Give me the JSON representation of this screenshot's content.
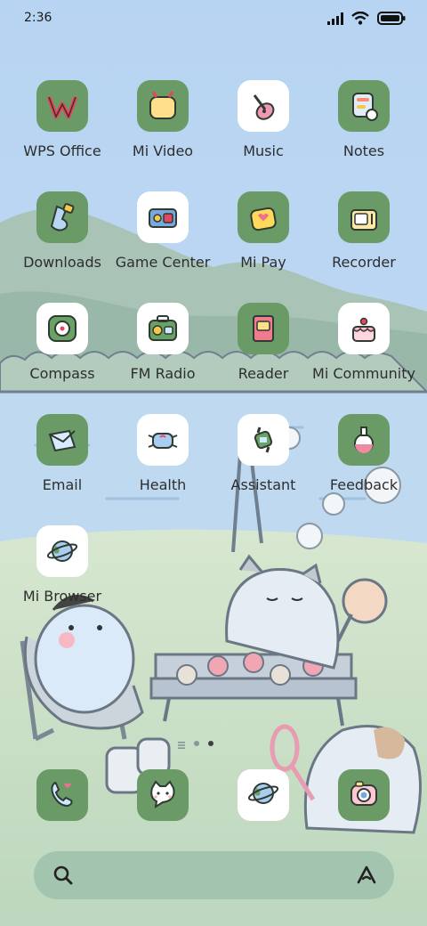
{
  "status_bar": {
    "time": "2:36",
    "icons": [
      "signal-icon",
      "wifi-icon",
      "battery-icon"
    ]
  },
  "apps": [
    {
      "label": "WPS Office",
      "icon": "wps-office-icon"
    },
    {
      "label": "Mi Video",
      "icon": "tv-icon"
    },
    {
      "label": "Music",
      "icon": "guitar-icon"
    },
    {
      "label": "Notes",
      "icon": "notes-icon"
    },
    {
      "label": "Downloads",
      "icon": "downloads-icon"
    },
    {
      "label": "Game Center",
      "icon": "game-console-icon"
    },
    {
      "label": "Mi Pay",
      "icon": "wallet-icon"
    },
    {
      "label": "Recorder",
      "icon": "radio-recorder-icon"
    },
    {
      "label": "Compass",
      "icon": "compass-icon"
    },
    {
      "label": "FM Radio",
      "icon": "fm-radio-icon"
    },
    {
      "label": "Reader",
      "icon": "book-icon"
    },
    {
      "label": "Mi Community",
      "icon": "cake-icon"
    },
    {
      "label": "Email",
      "icon": "envelope-icon"
    },
    {
      "label": "Health",
      "icon": "mask-icon"
    },
    {
      "label": "Assistant",
      "icon": "watch-icon"
    },
    {
      "label": "Feedback",
      "icon": "potion-icon"
    },
    {
      "label": "Mi Browser",
      "icon": "planet-icon"
    }
  ],
  "dock": [
    {
      "icon": "phone-icon"
    },
    {
      "icon": "cat-messages-icon"
    },
    {
      "icon": "planet-icon"
    },
    {
      "icon": "camera-icon"
    }
  ],
  "page_indicator": {
    "pages": 2,
    "active": 2
  },
  "search_bar": {
    "left_icon": "search-icon",
    "right_icon": "assistant-a-icon"
  },
  "colors": {
    "sky": "#bcd8f2",
    "mountain": "#a2bfb0",
    "grass": "#cfe3c6",
    "tile_green": "#6a9a66",
    "tile_white": "#ffffff",
    "label": "#2e2e2e"
  }
}
